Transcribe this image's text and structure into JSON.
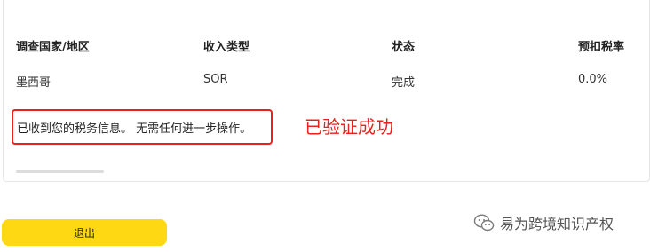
{
  "table": {
    "headers": [
      "调查国家/地区",
      "收入类型",
      "状态",
      "预扣税率"
    ],
    "row": [
      "墨西哥",
      "SOR",
      "完成",
      "0.0%"
    ]
  },
  "message": "已收到您的税务信息。 无需任何进一步操作。",
  "annotation": "已验证成功",
  "exit_button": "退出",
  "watermark": {
    "text": "易为跨境知识产权",
    "icon": "wechat-icon"
  },
  "colors": {
    "accent_yellow": "#ffd814",
    "annotation_red": "#e8221b"
  }
}
